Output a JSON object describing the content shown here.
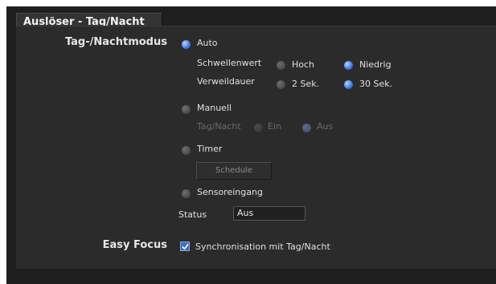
{
  "tab_title": "Auslöser - Tag/Nacht",
  "daynight": {
    "label": "Tag-/Nachtmodus",
    "auto_label": "Auto",
    "threshold_label": "Schwellenwert",
    "threshold_high": "Hoch",
    "threshold_low": "Niedrig",
    "dwell_label": "Verweildauer",
    "dwell_2": "2 Sek.",
    "dwell_30": "30 Sek.",
    "manual_label": "Manuell",
    "manual_sub_label": "Tag/Nacht",
    "manual_on": "Ein",
    "manual_off": "Aus",
    "timer_label": "Timer",
    "schedule_button": "Schedule",
    "sensor_label": "Sensoreingang",
    "status_label": "Status",
    "status_value": "Aus"
  },
  "easy_focus": {
    "label": "Easy Focus",
    "sync_label": "Synchronisation mit Tag/Nacht",
    "checked": true
  },
  "colors": {
    "panel_bg": "#2b2b2b",
    "accent_radio": "#3e78e0"
  }
}
